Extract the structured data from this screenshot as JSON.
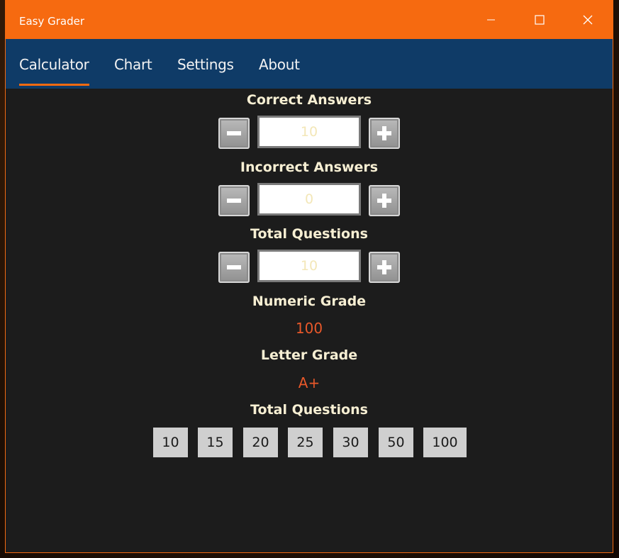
{
  "window": {
    "title": "Easy Grader",
    "accent_color": "#f66a10",
    "nav_color": "#0f3b67"
  },
  "nav": {
    "tabs": [
      {
        "label": "Calculator",
        "selected": true
      },
      {
        "label": "Chart",
        "selected": false
      },
      {
        "label": "Settings",
        "selected": false
      },
      {
        "label": "About",
        "selected": false
      }
    ]
  },
  "calculator": {
    "correct": {
      "label": "Correct Answers",
      "value": "10"
    },
    "incorrect": {
      "label": "Incorrect Answers",
      "value": "0"
    },
    "total": {
      "label": "Total Questions",
      "value": "10"
    },
    "numeric_grade": {
      "label": "Numeric Grade",
      "value": "100"
    },
    "letter_grade": {
      "label": "Letter Grade",
      "value": "A+"
    },
    "quick_totals": {
      "label": "Total Questions",
      "options": [
        "10",
        "15",
        "20",
        "25",
        "30",
        "50",
        "100"
      ]
    }
  },
  "icons": {
    "minus": "minus-icon",
    "plus": "plus-icon",
    "minimize": "minimize-icon",
    "maximize": "maximize-icon",
    "close": "close-icon"
  }
}
